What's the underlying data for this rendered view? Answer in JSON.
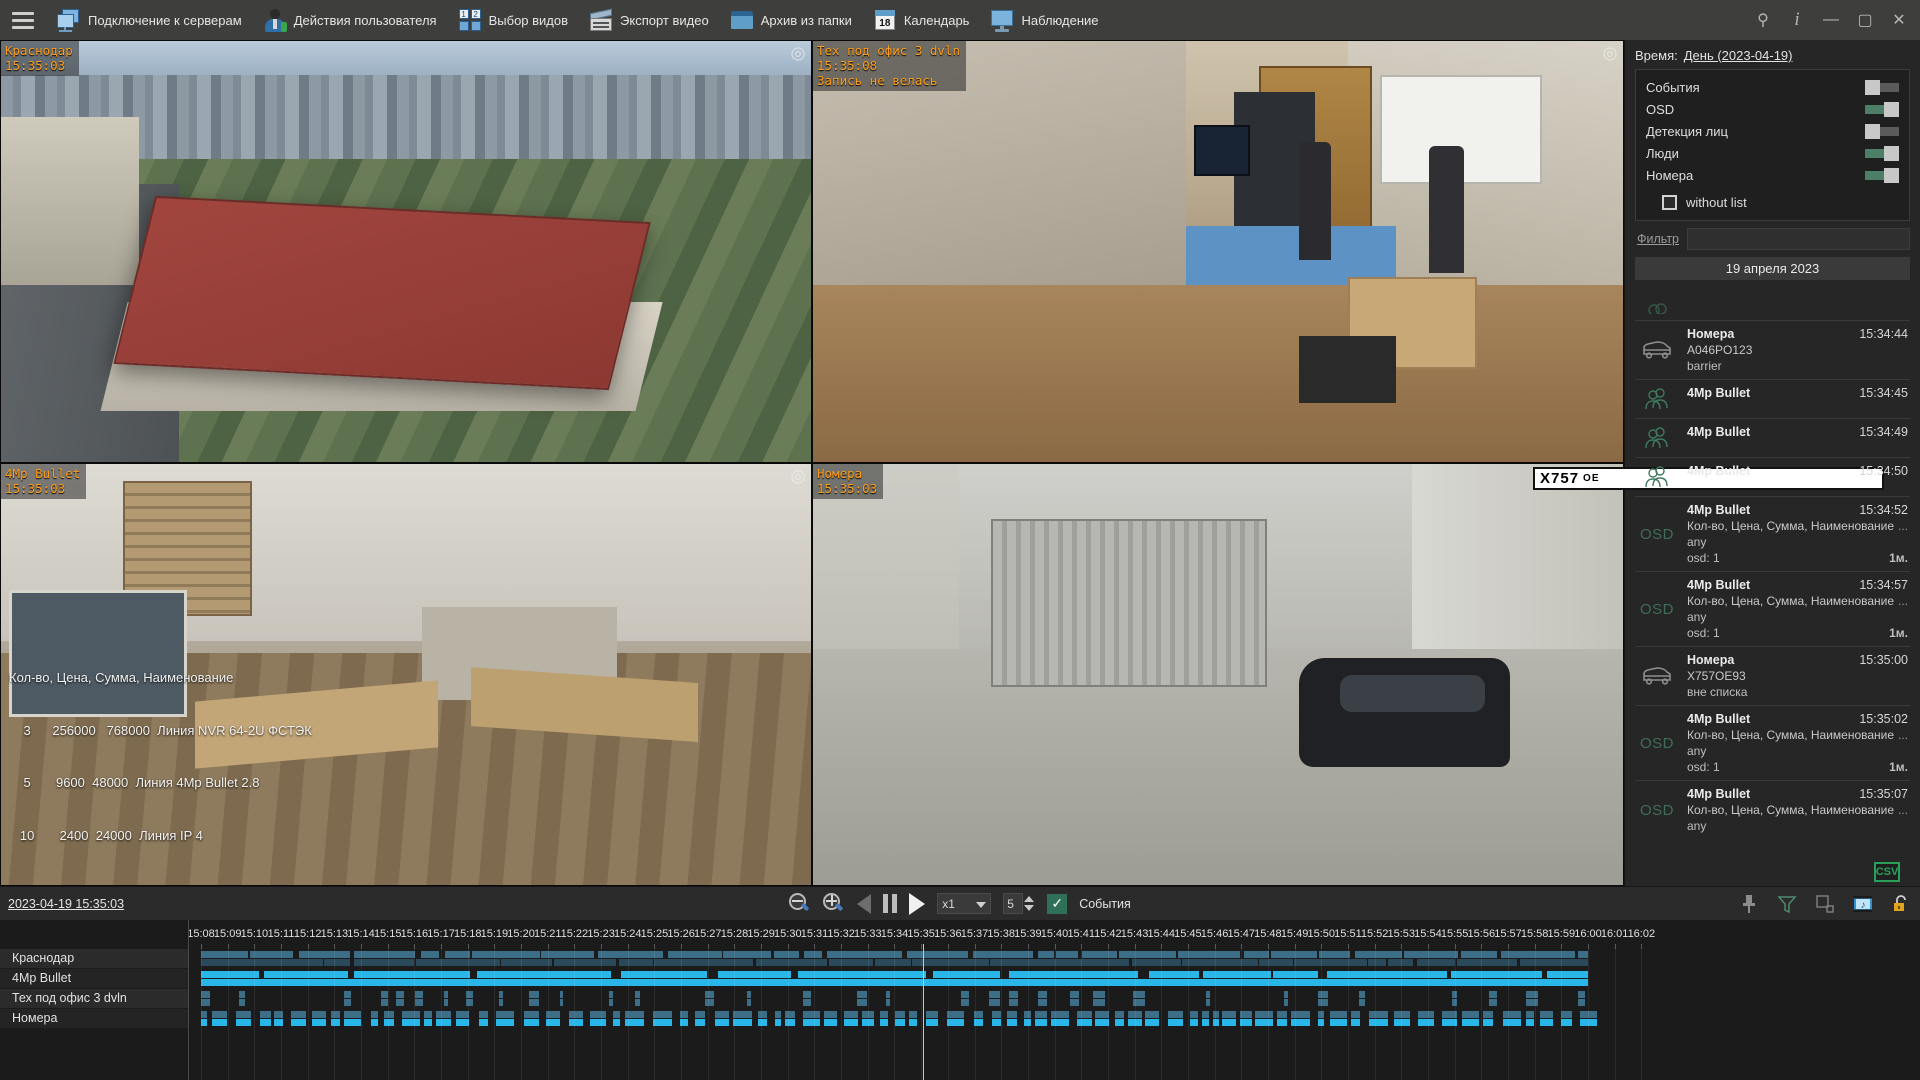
{
  "titlebar": {
    "menu_icon": "hamburger-icon",
    "buttons": [
      {
        "label": "Подключение к серверам",
        "icon": "servers-icon"
      },
      {
        "label": "Действия пользователя",
        "icon": "user-icon"
      },
      {
        "label": "Выбор видов",
        "icon": "views-icon"
      },
      {
        "label": "Экспорт видео",
        "icon": "export-video-icon"
      },
      {
        "label": "Архив из папки",
        "icon": "folder-icon"
      },
      {
        "label": "Календарь",
        "icon": "calendar-icon",
        "badge": "18"
      },
      {
        "label": "Наблюдение",
        "icon": "monitor-icon"
      }
    ],
    "window_controls": [
      {
        "name": "pin",
        "glyph": "⚲"
      },
      {
        "name": "info",
        "glyph": "i"
      },
      {
        "name": "minimize",
        "glyph": "—"
      },
      {
        "name": "maximize",
        "glyph": "▢"
      },
      {
        "name": "close",
        "glyph": "✕"
      }
    ]
  },
  "cameras": [
    {
      "name": "Краснодар",
      "time": "15:35:03",
      "note": "",
      "scene": "city"
    },
    {
      "name": "Тех под офис 3 dvln",
      "time": "15:35:08",
      "note": "Запись не велась",
      "scene": "server-room"
    },
    {
      "name": "4Mp Bullet",
      "time": "15:35:03",
      "note": "",
      "scene": "office"
    },
    {
      "name": "Номера",
      "time": "15:35:03",
      "note": "",
      "scene": "yard"
    }
  ],
  "osd_overlay": {
    "header": "Кол-во, Цена, Сумма, Наименование",
    "rows": [
      "    3      256000   768000  Линия NVR 64-2U ФСТЭК",
      "    5       9600  48000  Линия 4Mp Bullet 2.8",
      "   10       2400  24000  Линия IP 4"
    ]
  },
  "plate_overlay": {
    "main": "X757",
    "suffix": "OE"
  },
  "right_panel": {
    "time_label": "Время:",
    "time_value": "День (2023-04-19)",
    "toggles": [
      {
        "label": "События",
        "state": "off"
      },
      {
        "label": "OSD",
        "state": "on"
      },
      {
        "label": "Детекция лиц",
        "state": "off"
      },
      {
        "label": "Люди",
        "state": "on"
      },
      {
        "label": "Номера",
        "state": "on"
      }
    ],
    "checkbox": {
      "label": "without list",
      "checked": false
    },
    "filter_label": "Фильтр",
    "filter_value": "",
    "filter_placeholder": "",
    "date_header": "19 апреля 2023",
    "csv_badge": "CSV",
    "events": [
      {
        "icon": "car-icon",
        "title": "Номера",
        "time": "15:34:44",
        "sub": "A046PO123",
        "sub2": "barrier"
      },
      {
        "icon": "people-icon",
        "title": "4Mp Bullet",
        "time": "15:34:45",
        "sub": "",
        "sub2": ""
      },
      {
        "icon": "people-icon",
        "title": "4Mp Bullet",
        "time": "15:34:49",
        "sub": "",
        "sub2": ""
      },
      {
        "icon": "people-icon",
        "title": "4Mp Bullet",
        "time": "15:34:50",
        "sub": "",
        "sub2": ""
      },
      {
        "icon": "osd-icon",
        "title": "4Mp Bullet",
        "time": "15:34:52",
        "sub": "Кол-во, Цена, Сумма, Наименование",
        "dots": "...",
        "sub2": "any",
        "foot_left": "osd: 1",
        "foot_right": "1м."
      },
      {
        "icon": "osd-icon",
        "title": "4Mp Bullet",
        "time": "15:34:57",
        "sub": "Кол-во, Цена, Сумма, Наименование",
        "dots": "...",
        "sub2": "any",
        "foot_left": "osd: 1",
        "foot_right": "1м."
      },
      {
        "icon": "car-icon",
        "title": "Номера",
        "time": "15:35:00",
        "sub": "X757OE93",
        "sub2": "вне списка"
      },
      {
        "icon": "osd-icon",
        "title": "4Mp Bullet",
        "time": "15:35:02",
        "sub": "Кол-во, Цена, Сумма, Наименование",
        "dots": "...",
        "sub2": "any",
        "foot_left": "osd: 1",
        "foot_right": "1м."
      },
      {
        "icon": "osd-icon",
        "title": "4Mp Bullet",
        "time": "15:35:07",
        "sub": "Кол-во, Цена, Сумма, Наименование",
        "dots": "...",
        "sub2": "any",
        "foot_left": "",
        "foot_right": ""
      }
    ]
  },
  "controlbar": {
    "datetime": "2023-04-19 15:35:03",
    "zoom_out_icon": "zoom-out-icon",
    "zoom_in_icon": "zoom-in-icon",
    "step_back_icon": "step-back-icon",
    "pause_icon": "pause-icon",
    "play_icon": "play-icon",
    "speed_value": "x1",
    "step_value": "5",
    "events_checkbox_label": "События",
    "events_checked": true,
    "right_icons": [
      {
        "name": "pin-icon"
      },
      {
        "name": "filter-icon"
      },
      {
        "name": "layout-icon"
      },
      {
        "name": "film-icon"
      },
      {
        "name": "lock-icon"
      }
    ]
  },
  "timeline": {
    "rows": [
      {
        "label": "Краснодар"
      },
      {
        "label": "4Mp Bullet"
      },
      {
        "label": "Тех под офис 3 dvln"
      },
      {
        "label": "Номера"
      }
    ],
    "ticks": [
      "15:08",
      "15:09",
      "15:10",
      "15:11",
      "15:12",
      "15:13",
      "15:14",
      "15:15",
      "15:16",
      "15:17",
      "15:18",
      "15:19",
      "15:20",
      "15:21",
      "15:22",
      "15:23",
      "15:24",
      "15:25",
      "15:26",
      "15:27",
      "15:28",
      "15:29",
      "15:30",
      "15:31",
      "15:32",
      "15:33",
      "15:34",
      "15:35",
      "15:36",
      "15:37",
      "15:38",
      "15:39",
      "15:40",
      "15:41",
      "15:42",
      "15:43",
      "15:44",
      "15:45",
      "15:46",
      "15:47",
      "15:48",
      "15:49",
      "15:50",
      "15:51",
      "15:52",
      "15:53",
      "15:54",
      "15:55",
      "15:56",
      "15:57",
      "15:58",
      "15:59",
      "16:00",
      "16:01",
      "16:02"
    ],
    "cursor_time": "15:35:03",
    "colors": {
      "recorded": "#29b6e8",
      "sparse": "#3d6e87",
      "dim": "#2a4a5c"
    }
  }
}
